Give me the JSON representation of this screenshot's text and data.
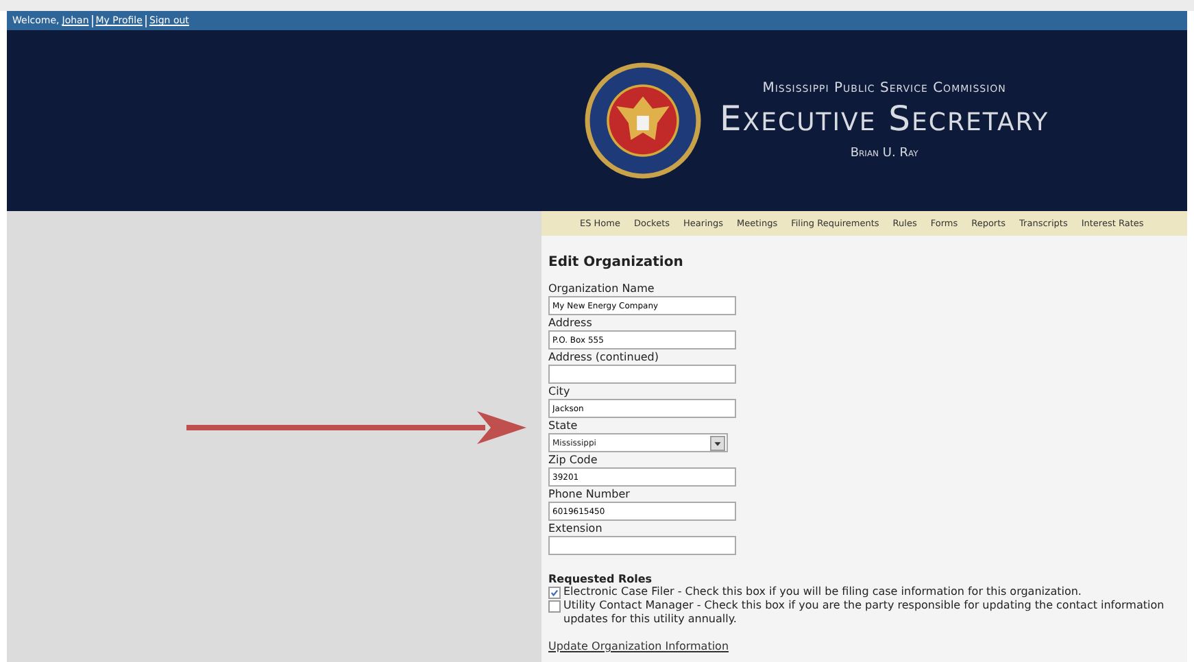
{
  "top_bar": {
    "welcome": "Welcome,",
    "links": [
      "Johan",
      "My Profile",
      "Sign out"
    ]
  },
  "header": {
    "org": "Mississippi Public Service Commission",
    "title": "Executive Secretary",
    "name": "Brian U. Ray"
  },
  "nav": [
    "ES Home",
    "Dockets",
    "Hearings",
    "Meetings",
    "Filing Requirements",
    "Rules",
    "Forms",
    "Reports",
    "Transcripts",
    "Interest Rates"
  ],
  "form": {
    "title": "Edit Organization",
    "fields": [
      {
        "kind": "text",
        "label": "Organization Name",
        "value": "My New Energy Company"
      },
      {
        "kind": "text",
        "label": "Address",
        "value": "P.O. Box 555"
      },
      {
        "kind": "text",
        "label": "Address (continued)"
      },
      {
        "kind": "text",
        "label": "City",
        "value": "Jackson"
      },
      {
        "kind": "select",
        "label": "State",
        "value": "Mississippi"
      },
      {
        "kind": "text",
        "label": "Zip Code",
        "value": "39201"
      },
      {
        "kind": "text",
        "label": "Phone Number",
        "value": "6019615450"
      },
      {
        "kind": "text",
        "label": "Extension"
      }
    ],
    "roles_title": "Requested Roles",
    "roles": [
      {
        "label": "Electronic Case Filer - Check this box if you will be filing case information for this organization.",
        "checked": true
      },
      {
        "label": "Utility Contact Manager - Check this box if you are the party responsible for updating the contact information updates for this utility annually.",
        "checked": false
      }
    ],
    "submit": "Update Organization Information"
  }
}
